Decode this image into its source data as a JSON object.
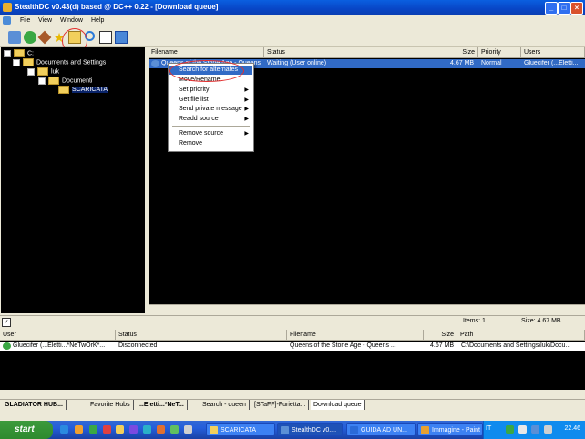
{
  "window": {
    "title": "StealthDC v0.43(d) based @ DC++ 0.22 - [Download queue]"
  },
  "menu": {
    "items": [
      "File",
      "View",
      "Window",
      "Help"
    ]
  },
  "tree": {
    "items": [
      {
        "label": "C:"
      },
      {
        "label": "Documents and Settings"
      },
      {
        "label": "luk"
      },
      {
        "label": "Documenti"
      },
      {
        "label": "SCARICATA"
      }
    ]
  },
  "queue": {
    "columns": [
      "Filename",
      "Status",
      "Size",
      "Priority",
      "Users"
    ],
    "row": {
      "filename": "Queens of the Stone Age - Queens",
      "status": "Waiting (User online)",
      "size": "4.67 MB",
      "priority": "Normal",
      "users": "Gluecifer (...Eletti..."
    }
  },
  "context_menu": {
    "items": [
      {
        "label": "Search for alternates",
        "submenu": false
      },
      {
        "label": "Move/Rename",
        "submenu": false
      },
      {
        "label": "Set priority",
        "submenu": true
      },
      {
        "label": "Get file list",
        "submenu": true
      },
      {
        "label": "Send private message",
        "submenu": true
      },
      {
        "label": "Readd source",
        "submenu": true
      },
      {
        "label": "Remove source",
        "submenu": true
      },
      {
        "label": "Remove",
        "submenu": false
      }
    ]
  },
  "status": {
    "items": "Items: 1",
    "size": "Size: 4.67 MB"
  },
  "transfers": {
    "columns": [
      "User",
      "Status",
      "Filename",
      "Size",
      "Path"
    ],
    "row": {
      "user": "Gluecifer (...Eletti...*NeTwOrK*...",
      "status": "Disconnected",
      "filename": "Queens of the Stone Age - Queens ...",
      "size": "4.67 MB",
      "path": "C:\\Documents and Settings\\luk\\Docu..."
    }
  },
  "tabs": [
    {
      "label": "GLADIATOR HUB..."
    },
    {
      "label": "Favorite Hubs"
    },
    {
      "label": "...Eletti...*NeT..."
    },
    {
      "label": "Search - queen"
    },
    {
      "label": "[STaFF]-Furietta..."
    },
    {
      "label": "Download queue"
    }
  ],
  "taskbar": {
    "start": "start",
    "tasks": [
      {
        "label": "SCARICATA"
      },
      {
        "label": "StealthDC v0...."
      },
      {
        "label": "GUIDA AD UN..."
      },
      {
        "label": "Immagine - Paint"
      }
    ],
    "lang": "IT",
    "clock": "22.46"
  }
}
